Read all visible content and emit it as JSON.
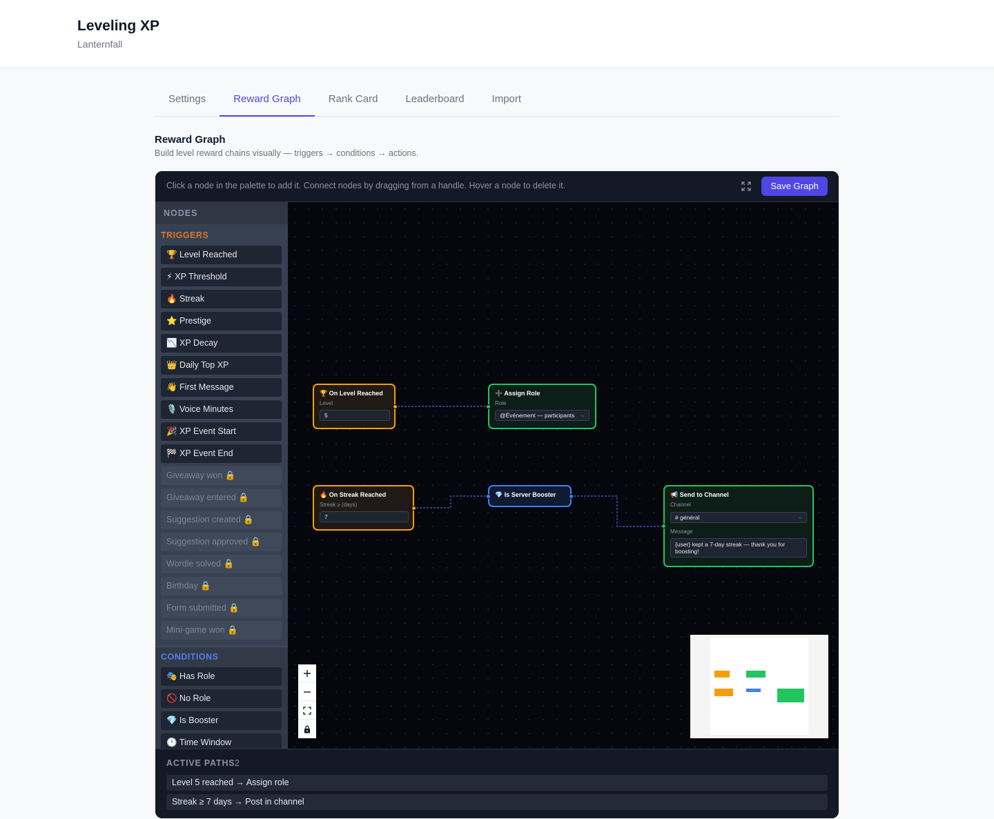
{
  "header": {
    "title": "Leveling XP",
    "subtitle": "Lanternfall"
  },
  "tabs": [
    {
      "label": "Settings",
      "active": false
    },
    {
      "label": "Reward Graph",
      "active": true
    },
    {
      "label": "Rank Card",
      "active": false
    },
    {
      "label": "Leaderboard",
      "active": false
    },
    {
      "label": "Import",
      "active": false
    }
  ],
  "section": {
    "title": "Reward Graph",
    "description": "Build level reward chains visually — triggers → conditions → actions."
  },
  "editor": {
    "hint": "Click a node in the palette to add it. Connect nodes by dragging from a handle. Hover a node to delete it.",
    "save_label": "Save Graph"
  },
  "palette": {
    "heading": "NODES",
    "triggers_label": "TRIGGERS",
    "conditions_label": "CONDITIONS",
    "triggers": [
      {
        "label": "🏆 Level Reached",
        "locked": false
      },
      {
        "label": "⚡ XP Threshold",
        "locked": false
      },
      {
        "label": "🔥 Streak",
        "locked": false
      },
      {
        "label": "⭐ Prestige",
        "locked": false
      },
      {
        "label": "📉 XP Decay",
        "locked": false
      },
      {
        "label": "👑 Daily Top XP",
        "locked": false
      },
      {
        "label": "👋 First Message",
        "locked": false
      },
      {
        "label": "🎙️ Voice Minutes",
        "locked": false
      },
      {
        "label": "🎉 XP Event Start",
        "locked": false
      },
      {
        "label": "🏁 XP Event End",
        "locked": false
      },
      {
        "label": "Giveaway won 🔒",
        "locked": true
      },
      {
        "label": "Giveaway entered 🔒",
        "locked": true
      },
      {
        "label": "Suggestion created 🔒",
        "locked": true
      },
      {
        "label": "Suggestion approved 🔒",
        "locked": true
      },
      {
        "label": "Wordle solved 🔒",
        "locked": true
      },
      {
        "label": "Birthday 🔒",
        "locked": true
      },
      {
        "label": "Form submitted 🔒",
        "locked": true
      },
      {
        "label": "Mini-game won 🔒",
        "locked": true
      }
    ],
    "conditions": [
      {
        "label": "🎭 Has Role",
        "locked": false
      },
      {
        "label": "🚫 No Role",
        "locked": false
      },
      {
        "label": "💎 Is Booster",
        "locked": false
      },
      {
        "label": "🕐 Time Window",
        "locked": false
      }
    ]
  },
  "nodes": {
    "level_reached": {
      "title": "🏆 On Level Reached",
      "field_label": "Level",
      "value": "5"
    },
    "assign_role": {
      "title": "➕ Assign Role",
      "field_label": "Role",
      "value": "@Événement — participants"
    },
    "streak_reached": {
      "title": "🔥 On Streak Reached",
      "field_label": "Streak ≥ (days)",
      "value": "7"
    },
    "server_booster": {
      "title": "💎 Is Server Booster"
    },
    "send_channel": {
      "title": "📢 Send to Channel",
      "channel_label": "Channel",
      "channel_value": "# général",
      "message_label": "Message",
      "message_value": "{user} kept a 7-day streak — thank you for boosting!"
    }
  },
  "colors": {
    "trigger": "#f59e0b",
    "action": "#22c55e",
    "condition": "#3b82f6",
    "accent": "#4f46e5"
  },
  "active_paths": {
    "title": "ACTIVE PATHS",
    "count": "2",
    "items": [
      "Level 5 reached → Assign role",
      "Streak ≥ 7 days → Post in channel"
    ]
  }
}
